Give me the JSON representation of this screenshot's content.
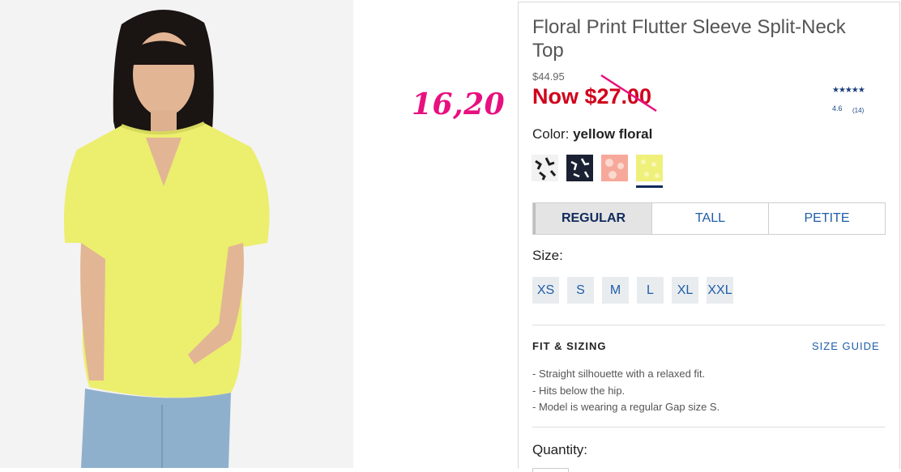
{
  "product": {
    "title": "Floral Print Flutter Sleeve Split-Neck Top",
    "original_price": "$44.95",
    "sale_price": "Now $27.00",
    "rating_stars": "★★★★★",
    "rating_value": "4.6",
    "review_count": "(14)"
  },
  "annotation": {
    "text": "16,20",
    "color": "#e8107f"
  },
  "color": {
    "label": "Color:",
    "selected": "yellow floral",
    "swatches": [
      {
        "name": "white floral",
        "bg": "#f2f2f2",
        "fg": "#1e1e1e"
      },
      {
        "name": "navy floral",
        "bg": "#1b2133",
        "fg": "#ffffff"
      },
      {
        "name": "pink floral",
        "bg": "#f6a99a",
        "fg": "#fbd9cf"
      },
      {
        "name": "yellow floral",
        "bg": "#eff07a",
        "fg": "#f8f7b5"
      }
    ]
  },
  "fit_tabs": [
    "REGULAR",
    "TALL",
    "PETITE"
  ],
  "size": {
    "label": "Size:",
    "options": [
      "XS",
      "S",
      "M",
      "L",
      "XL",
      "XXL"
    ]
  },
  "details": {
    "heading": "FIT & SIZING",
    "size_guide": "SIZE GUIDE",
    "bullets": [
      "- Straight silhouette with a relaxed fit.",
      "- Hits below the hip.",
      "- Model is wearing a regular Gap size S."
    ]
  },
  "quantity": {
    "label": "Quantity:"
  },
  "colors": {
    "sale_red": "#d0021b",
    "link_blue": "#1f5da8",
    "navy": "#102a5c"
  }
}
